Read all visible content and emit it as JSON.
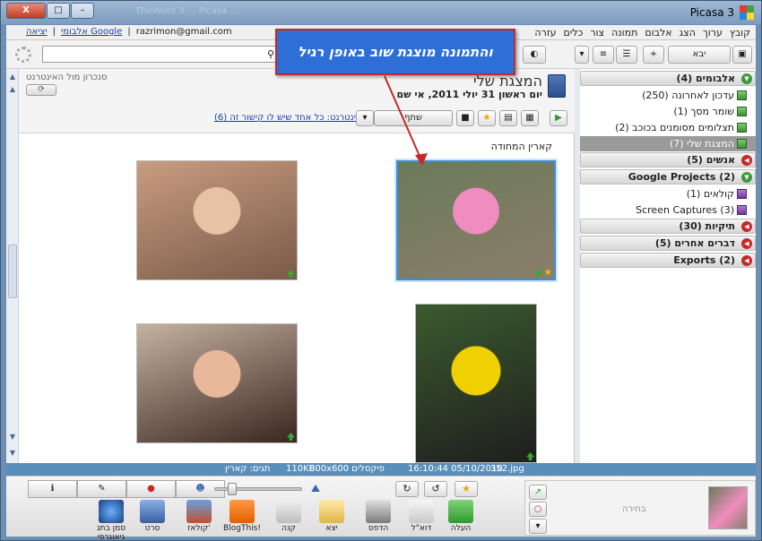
{
  "window": {
    "title": "Picasa 3",
    "ghost_title": "ThinNote 3 ... Picasa ...",
    "controls": {
      "minimize": "–",
      "maximize": "□",
      "close": "X"
    }
  },
  "menu": {
    "items": [
      "קובץ",
      "ערוך",
      "הצג",
      "אלבום",
      "תמונה",
      "צור",
      "כלים",
      "עזרה"
    ],
    "user_email": "razrimon@gmail.com",
    "google_albums_link": "אלבומי Google",
    "exit_link": "יציאה",
    "separator": "|"
  },
  "toolbar": {
    "import_label": "יבא",
    "search_placeholder": ""
  },
  "callout": {
    "text": "והתמונה מוצגת שוב באופן רגיל"
  },
  "album": {
    "title": "המצגת שלי",
    "date": "יום ראשון 31 יולי 2011, אי שם",
    "sync_label": "סנכרון מול האינטרנט",
    "share_label": "שתף",
    "share_link": "הצג באינטרנט: כל אחד שיש לו קישור זה (6)",
    "photo_caption": "קארין המחודה"
  },
  "photos": [
    {
      "name": "baby-blanket",
      "selected": true,
      "starred": true,
      "colors": [
        "#6b7a5a",
        "#f08cbf",
        "#8a7e6a"
      ]
    },
    {
      "name": "baby-sleeping",
      "selected": false,
      "starred": false,
      "colors": [
        "#c99c80",
        "#e8c2a4",
        "#7a5a48"
      ]
    },
    {
      "name": "bee-costume",
      "selected": false,
      "starred": false,
      "colors": [
        "#3b5a2e",
        "#f0d000",
        "#1e1e1e"
      ]
    },
    {
      "name": "girl-beach",
      "selected": false,
      "starred": false,
      "colors": [
        "#c5b2a0",
        "#e9b89b",
        "#3a2620"
      ]
    }
  ],
  "sidebar": {
    "sections": [
      {
        "label": "אלבומים (4)",
        "open": true,
        "items": [
          "עדכון לאחרונה (250)",
          "שומר מסך (1)",
          "תצלומים מסומנים בכוכב (2)",
          "המצגת שלי (7)"
        ],
        "active_index": 3
      },
      {
        "label": "אנשים (5)",
        "open": false,
        "items": []
      },
      {
        "label": "Google Projects (2)",
        "open": true,
        "items": [
          "קולאים (1)",
          "Screen Captures (3)"
        ]
      },
      {
        "label": "תיקיות (30)",
        "open": false,
        "items": []
      },
      {
        "label": "דברים אחרים (5)",
        "open": false,
        "items": []
      },
      {
        "label": "Exports (2)",
        "open": false,
        "items": []
      }
    ]
  },
  "status": {
    "filename": "352.jpg",
    "datetime": "16:10:44 05/10/2010",
    "dimensions": "800x600 פיקסלים",
    "size": "110KB",
    "tags": "תגים: קארין"
  },
  "bottom": {
    "tray_label": "בחירה",
    "actions": [
      "העלה",
      "דוא\"ל",
      "הדפס",
      "יצא",
      "קנה",
      "BlogThis!",
      "קולאז'",
      "סרט",
      "סמן בתג גיאוגרפי"
    ],
    "segment_icons": [
      "info-icon",
      "tag-icon",
      "pin-icon",
      "person-icon"
    ]
  },
  "colors": {
    "accent": "#2d6fd7",
    "callout_border": "#c62828",
    "status_bar": "#5a8fbc",
    "open_section": "#3a9a3a",
    "closed_section": "#c62828"
  }
}
